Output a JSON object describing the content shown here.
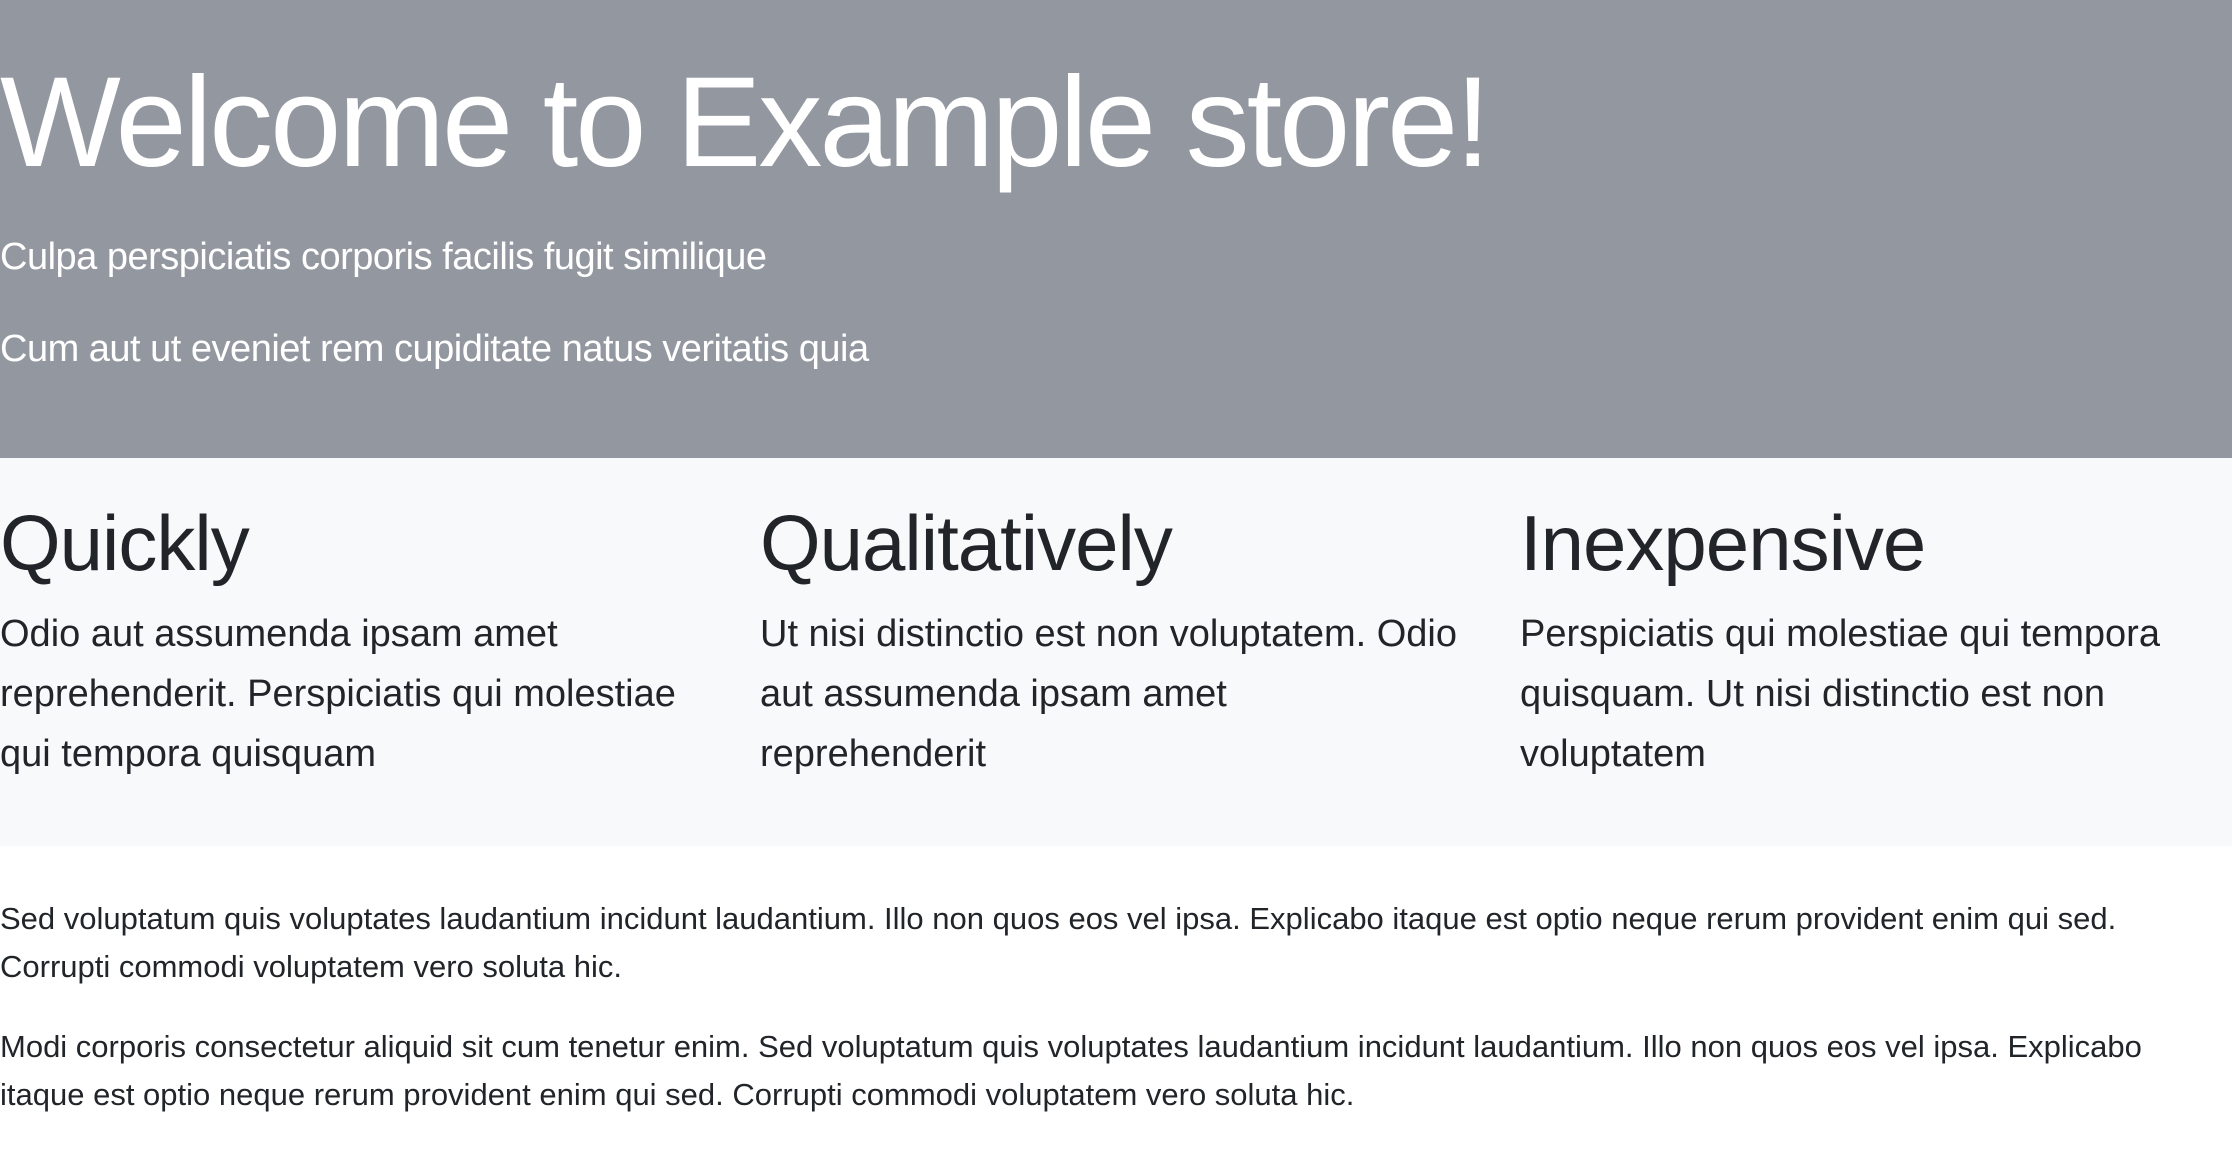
{
  "hero": {
    "title": "Welcome to Example store!",
    "line1": "Culpa perspiciatis corporis facilis fugit similique",
    "line2": "Cum aut ut eveniet rem cupiditate natus veritatis quia"
  },
  "features": [
    {
      "title": "Quickly",
      "text": "Odio aut assumenda ipsam amet reprehenderit. Perspiciatis qui molestiae qui tempora quisquam"
    },
    {
      "title": "Qualitatively",
      "text": "Ut nisi distinctio est non voluptatem. Odio aut assumenda ipsam amet reprehenderit"
    },
    {
      "title": "Inexpensive",
      "text": "Perspiciatis qui molestiae qui tempora quisquam. Ut nisi distinctio est non voluptatem"
    }
  ],
  "body": {
    "paragraph1": "Sed voluptatum quis voluptates laudantium incidunt laudantium. Illo non quos eos vel ipsa. Explicabo itaque est optio neque rerum provident enim qui sed. Corrupti commodi voluptatem vero soluta hic.",
    "paragraph2": "Modi corporis consectetur aliquid sit cum tenetur enim. Sed voluptatum quis voluptates laudantium incidunt laudantium. Illo non quos eos vel ipsa. Explicabo itaque est optio neque rerum provident enim qui sed. Corrupti commodi voluptatem vero soluta hic."
  },
  "colors": {
    "hero_background": "#9397a0",
    "features_background": "#f8f9fa",
    "text": "#212529"
  }
}
